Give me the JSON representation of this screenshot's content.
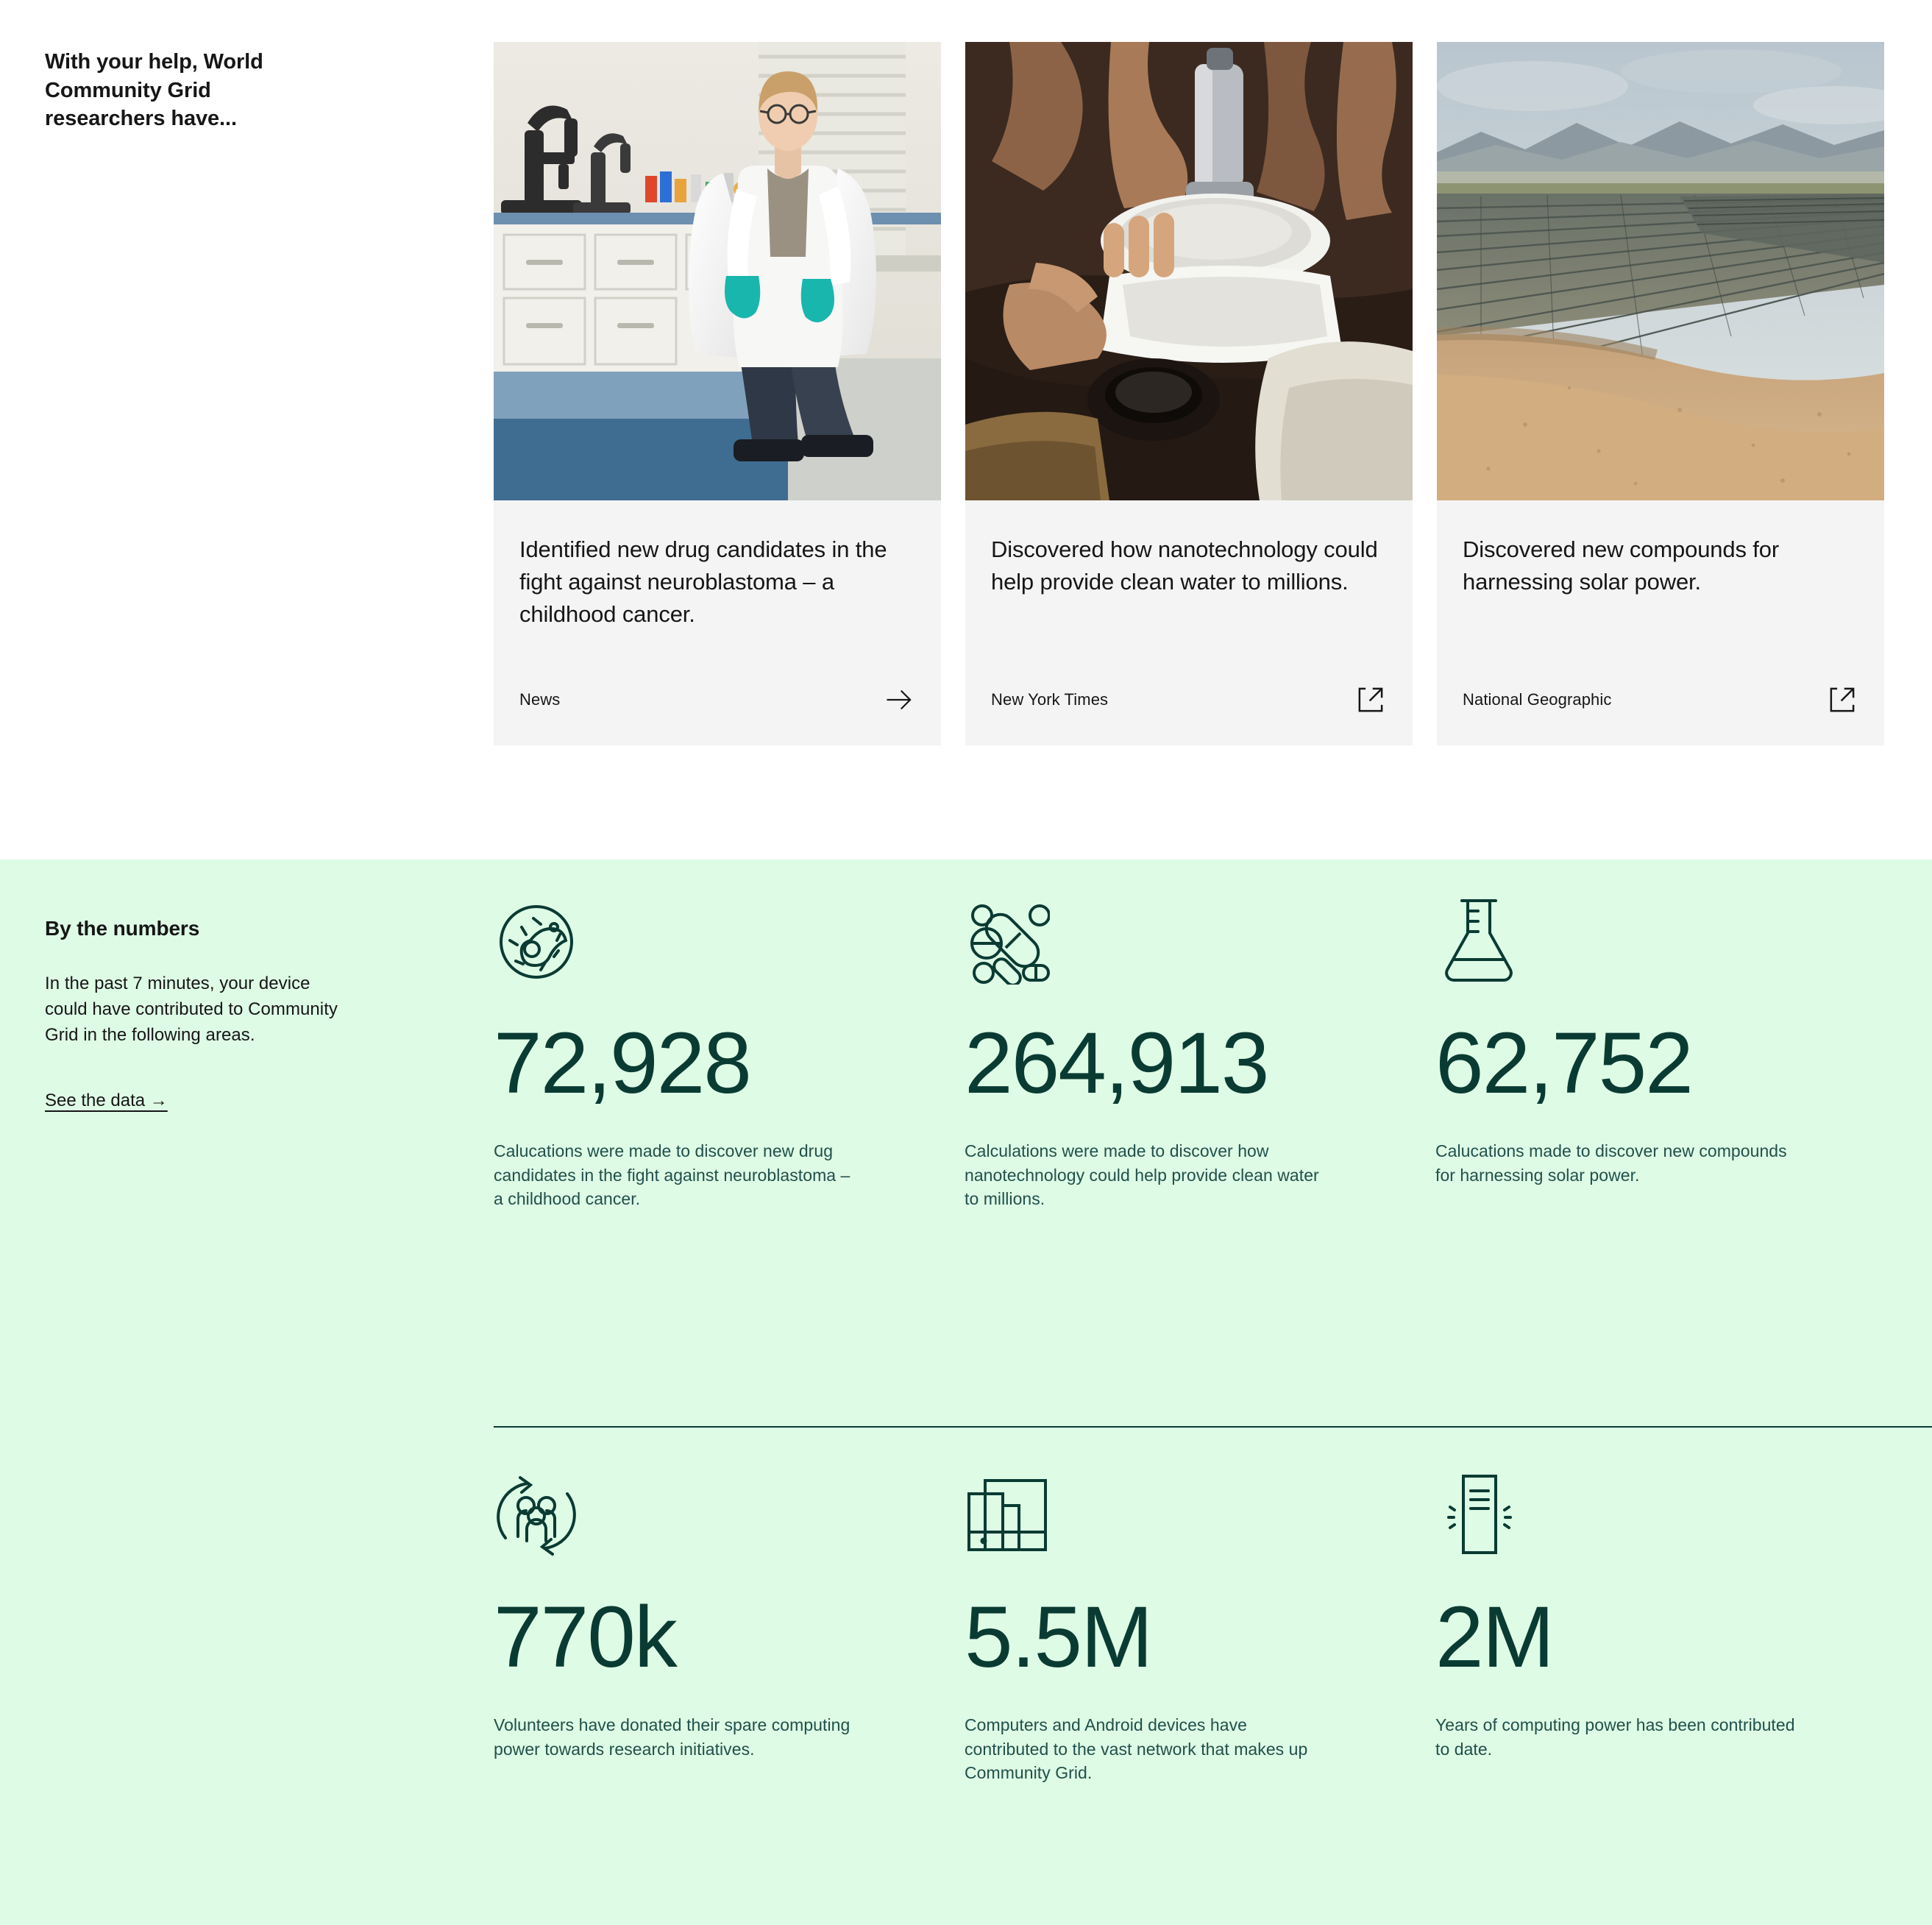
{
  "intro": {
    "heading": "With your help, World Community Grid researchers have..."
  },
  "cards": [
    {
      "image_alt": "scientist-in-laboratory",
      "title": "Identified new drug candidates in the fight against neuroblastoma – a childhood cancer.",
      "source": "News",
      "icon": "arrow-right-icon"
    },
    {
      "image_alt": "hands-filtering-water",
      "title": "Discovered how nanotechnology could help provide clean water to millions.",
      "source": "New York Times",
      "icon": "external-link-icon"
    },
    {
      "image_alt": "solar-panel-farm-aerial",
      "title": "Discovered new compounds for harnessing solar power.",
      "source": "National Geographic",
      "icon": "external-link-icon"
    }
  ],
  "numbers": {
    "title": "By the numbers",
    "description": "In the past 7 minutes, your device could have contributed to Community Grid in the following areas.",
    "link_label": "See the data →"
  },
  "stats_row1": [
    {
      "icon": "cell-biology-icon",
      "value": "72,928",
      "description": "Calucations were made to discover new drug candidates in the fight against neuroblastoma – a childhood cancer."
    },
    {
      "icon": "pills-capsules-icon",
      "value": "264,913",
      "description": "Calculations were made to discover how nanotechnology could help provide clean water to millions."
    },
    {
      "icon": "erlenmeyer-flask-icon",
      "value": "62,752",
      "description": "Calucations made to discover new compounds for harnessing solar power."
    }
  ],
  "stats_row2": [
    {
      "icon": "community-people-cycle-icon",
      "value": "770k",
      "description": "Volunteers have donated their spare computing power towards research initiatives."
    },
    {
      "icon": "devices-icon",
      "value": "5.5M",
      "description": "Computers and Android devices have contributed to the vast network that makes up Community Grid."
    },
    {
      "icon": "server-signal-icon",
      "value": "2M",
      "description": "Years of computing power has been contributed to date."
    }
  ],
  "colors": {
    "green_background": "#defbe6",
    "stat_number": "#0a3b33",
    "card_background": "#f4f4f4",
    "text_primary": "#161616"
  }
}
